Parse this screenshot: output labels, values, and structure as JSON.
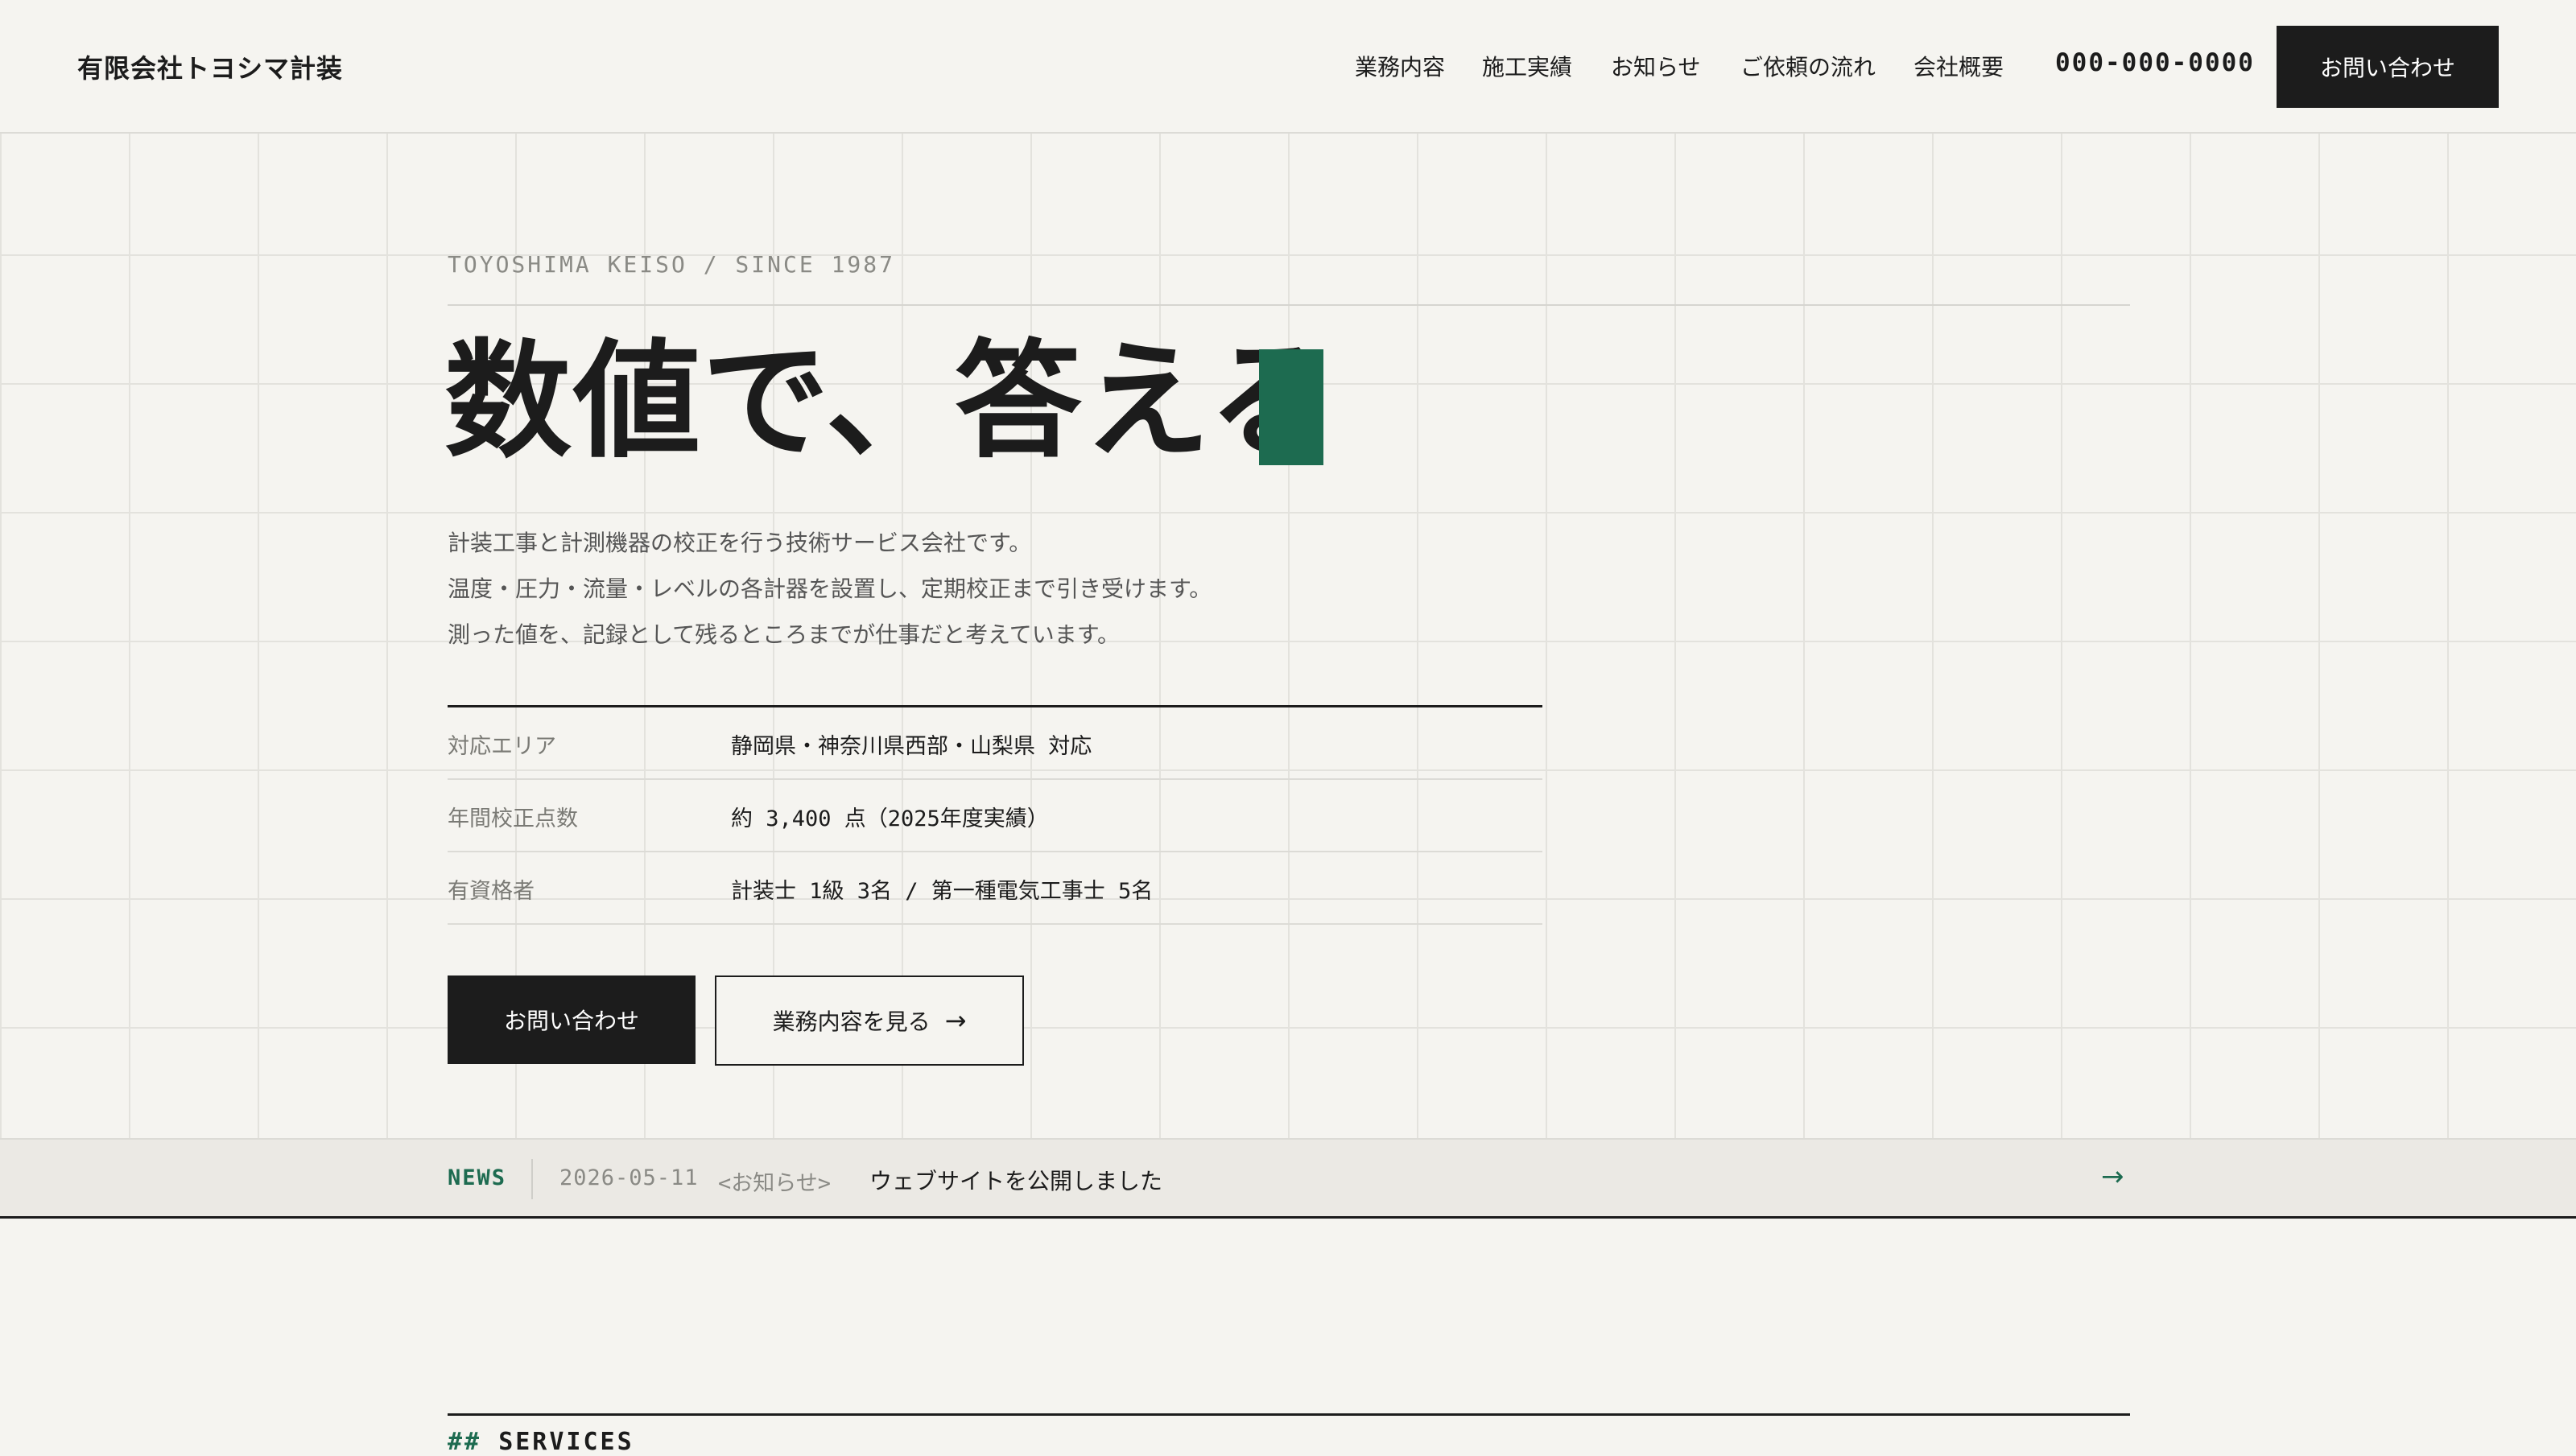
{
  "header": {
    "logo": "有限会社トヨシマ計装",
    "nav": [
      "業務内容",
      "施工実績",
      "お知らせ",
      "ご依頼の流れ",
      "会社概要"
    ],
    "phone": "000-000-0000",
    "cta_label": "お問い合わせ"
  },
  "hero": {
    "eyebrow": "TOYOSHIMA KEISO / SINCE 1987",
    "title": "数値で、答える",
    "lead": [
      "計装工事と計測機器の校正を行う技術サービス会社です。",
      "温度・圧力・流量・レベルの各計器を設置し、定期校正まで引き受けます。",
      "測った値を、記録として残るところまでが仕事だと考えています。"
    ],
    "spec": [
      {
        "label": "対応エリア",
        "value": "静岡県・神奈川県西部・山梨県 対応"
      },
      {
        "label": "年間校正点数",
        "value": "約 3,400 点（2025年度実績）"
      },
      {
        "label": "有資格者",
        "value": "計装士 1級 3名 / 第一種電気工事士 5名"
      }
    ],
    "primary_button": "お問い合わせ",
    "secondary_button": "業務内容を見る",
    "secondary_arrow": "→"
  },
  "news": {
    "tag": "NEWS",
    "date": "2026-05-11",
    "category": "<お知らせ>",
    "title": "ウェブサイトを公開しました",
    "arrow": "→"
  },
  "services": {
    "hash": "##",
    "heading": "SERVICES"
  },
  "colors": {
    "accent": "#1d6b50",
    "dark": "#1c1c1c",
    "background": "#f5f4f0"
  }
}
